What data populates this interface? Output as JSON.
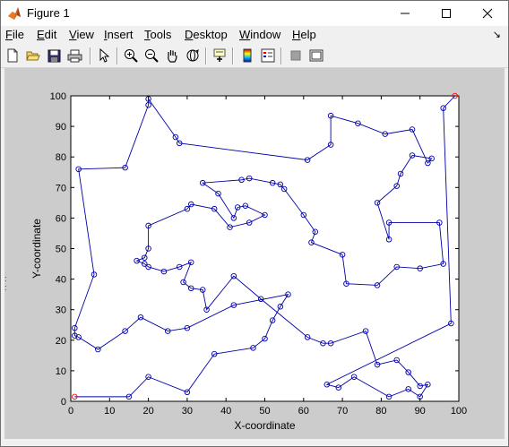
{
  "window": {
    "title": "Figure 1",
    "controls": {
      "minimize": "—",
      "maximize": "☐",
      "close": "✕"
    }
  },
  "menu": {
    "items": [
      {
        "label": "File",
        "u": "F",
        "rest": "ile"
      },
      {
        "label": "Edit",
        "u": "E",
        "rest": "dit"
      },
      {
        "label": "View",
        "u": "V",
        "rest": "iew"
      },
      {
        "label": "Insert",
        "u": "I",
        "rest": "nsert"
      },
      {
        "label": "Tools",
        "u": "T",
        "rest": "ools"
      },
      {
        "label": "Desktop",
        "u": "D",
        "rest": "esktop"
      },
      {
        "label": "Window",
        "u": "W",
        "rest": "indow"
      },
      {
        "label": "Help",
        "u": "H",
        "rest": "elp"
      }
    ],
    "dock_glyph": "↘"
  },
  "toolbar": {
    "buttons": [
      "new-figure-icon",
      "open-file-icon",
      "save-icon",
      "print-icon",
      "pointer-icon",
      "zoom-in-icon",
      "zoom-out-icon",
      "pan-hand-icon",
      "rotate-3d-icon",
      "data-cursor-icon",
      "colorbar-icon",
      "legend-icon",
      "hide-plot-tools-icon",
      "show-plot-tools-icon"
    ]
  },
  "colors": {
    "plot_line": "#0000aa",
    "marker": "#0000aa",
    "endpoint_marker": "#ff0000",
    "figure_bg": "#cccccc",
    "axes_bg": "#ffffff"
  },
  "chart_data": {
    "type": "line",
    "xlabel": "X-coordinate",
    "ylabel": "Y-coordinate",
    "xlim": [
      0,
      100
    ],
    "ylim": [
      0,
      100
    ],
    "xticks": [
      0,
      10,
      20,
      30,
      40,
      50,
      60,
      70,
      80,
      90,
      100
    ],
    "yticks": [
      0,
      10,
      20,
      30,
      40,
      50,
      60,
      70,
      80,
      90,
      100
    ],
    "grid": false,
    "marker": "circle",
    "route": [
      [
        1,
        1.5
      ],
      [
        15,
        1.5
      ],
      [
        20,
        8
      ],
      [
        30,
        3
      ],
      [
        37,
        15.5
      ],
      [
        47,
        17.5
      ],
      [
        50,
        20.5
      ],
      [
        52,
        26.5
      ],
      [
        54,
        31
      ],
      [
        56,
        35
      ],
      [
        42,
        31.5
      ],
      [
        30,
        24
      ],
      [
        25,
        23
      ],
      [
        18,
        27.5
      ],
      [
        14,
        23
      ],
      [
        7,
        17
      ],
      [
        2,
        21
      ],
      [
        1,
        21.5
      ],
      [
        1,
        24
      ],
      [
        6,
        41.5
      ],
      [
        2,
        76
      ],
      [
        14,
        76.5
      ],
      [
        20,
        97
      ],
      [
        20,
        99
      ],
      [
        27,
        86.5
      ],
      [
        28,
        84.5
      ],
      [
        61,
        79
      ],
      [
        67,
        84
      ],
      [
        67,
        93.5
      ],
      [
        74,
        91
      ],
      [
        81,
        87.5
      ],
      [
        88,
        89
      ],
      [
        92,
        78
      ],
      [
        93,
        79.5
      ],
      [
        88,
        80.5
      ],
      [
        85,
        74.5
      ],
      [
        84,
        70.5
      ],
      [
        79,
        65
      ],
      [
        82,
        53
      ],
      [
        82,
        58.5
      ],
      [
        95,
        58.5
      ],
      [
        96,
        45
      ],
      [
        90,
        43.5
      ],
      [
        84,
        44
      ],
      [
        79,
        38
      ],
      [
        71,
        38.5
      ],
      [
        70,
        48
      ],
      [
        62,
        52
      ],
      [
        63,
        55.5
      ],
      [
        60,
        61
      ],
      [
        55,
        69.5
      ],
      [
        54,
        71
      ],
      [
        52,
        71.5
      ],
      [
        46,
        73
      ],
      [
        44,
        72.5
      ],
      [
        34,
        71.5
      ],
      [
        38,
        68
      ],
      [
        42,
        60
      ],
      [
        43,
        63.5
      ],
      [
        45,
        64
      ],
      [
        50,
        61
      ],
      [
        46,
        58.5
      ],
      [
        41,
        57
      ],
      [
        37,
        63
      ],
      [
        31,
        64.5
      ],
      [
        30,
        63
      ],
      [
        20,
        57.5
      ],
      [
        20,
        50
      ],
      [
        19,
        47
      ],
      [
        17,
        46
      ],
      [
        19,
        45
      ],
      [
        20,
        44
      ],
      [
        24,
        42.5
      ],
      [
        28,
        44
      ],
      [
        31,
        45.5
      ],
      [
        29,
        39
      ],
      [
        31,
        37
      ],
      [
        34,
        36.5
      ],
      [
        35,
        30
      ],
      [
        42,
        41
      ],
      [
        49,
        33.5
      ],
      [
        61,
        21
      ],
      [
        65,
        19
      ],
      [
        67,
        19
      ],
      [
        76,
        23
      ],
      [
        79,
        12
      ],
      [
        84,
        13.5
      ],
      [
        87,
        9.5
      ],
      [
        90,
        5
      ],
      [
        92,
        5.5
      ],
      [
        90,
        1.5
      ],
      [
        87,
        4
      ],
      [
        82,
        1.5
      ],
      [
        73,
        8
      ],
      [
        69,
        4.5
      ],
      [
        66,
        5.5
      ],
      [
        98,
        25.5
      ],
      [
        96,
        96
      ],
      [
        99,
        100
      ]
    ]
  }
}
